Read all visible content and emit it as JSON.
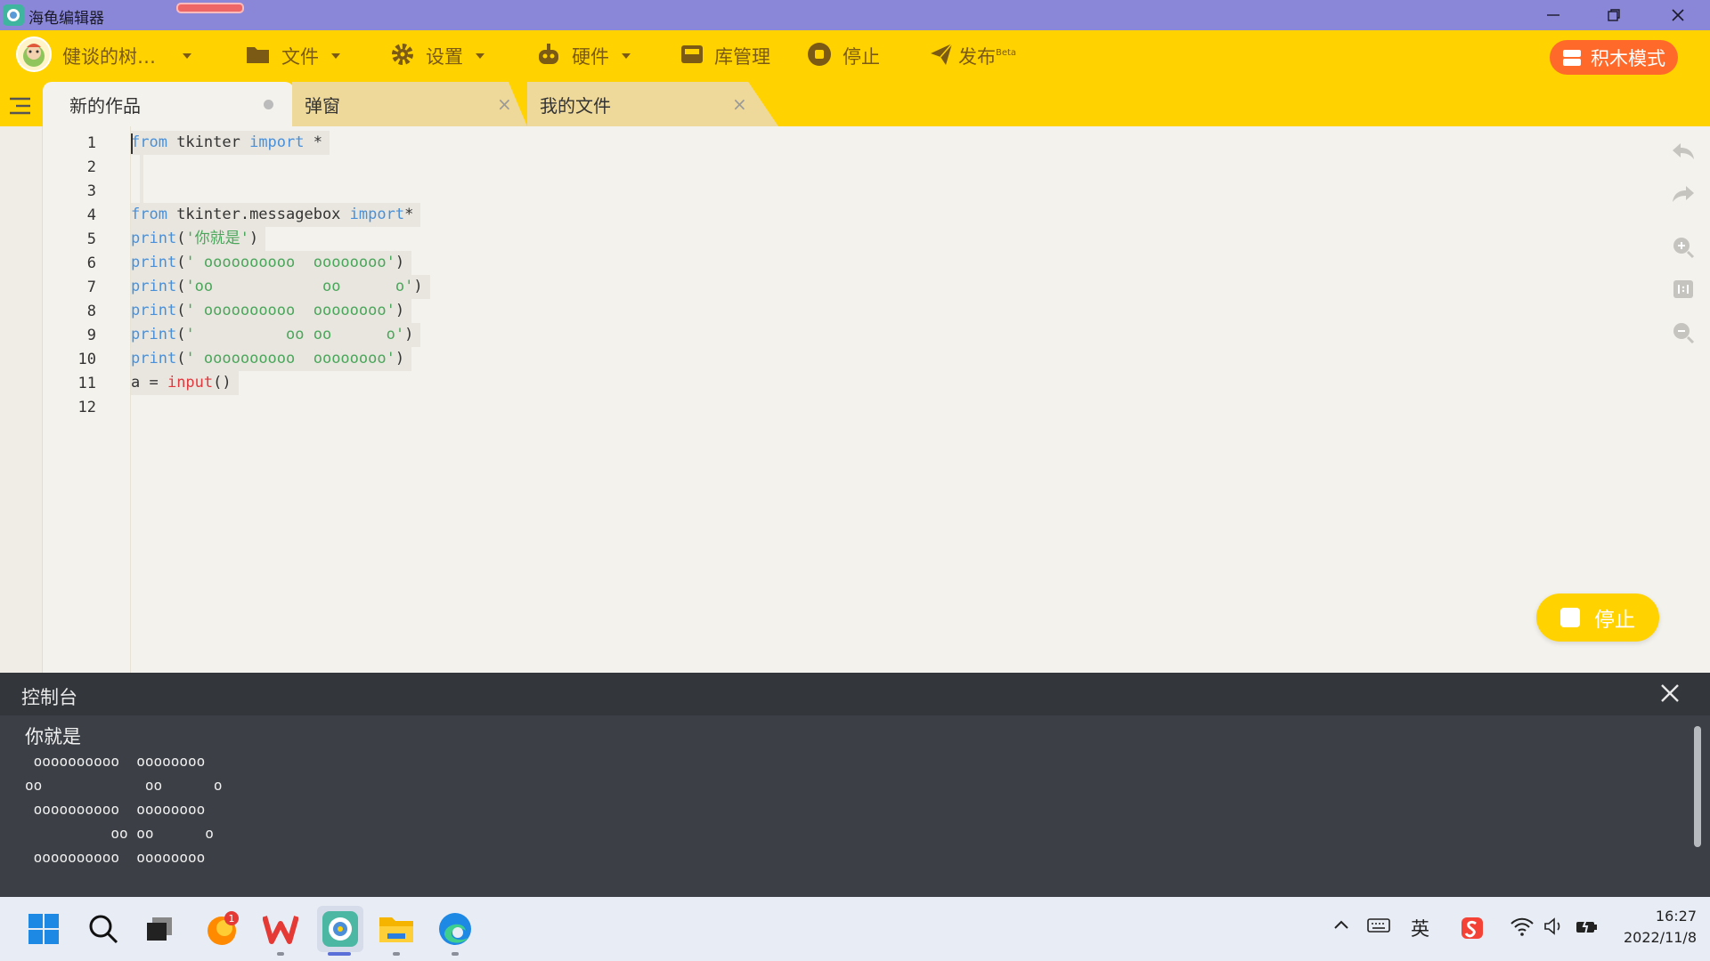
{
  "window": {
    "title": "海龟编辑器",
    "controls": [
      "minimize",
      "maximize",
      "close"
    ]
  },
  "toolbar": {
    "user_name": "健谈的树…",
    "file_label": "文件",
    "settings_label": "设置",
    "hardware_label": "硬件",
    "library_label": "库管理",
    "stop_label": "停止",
    "publish_label": "发布",
    "publish_badge": "Beta",
    "block_mode_label": "积木模式"
  },
  "tabs": [
    {
      "label": "新的作品",
      "state": "unsaved"
    },
    {
      "label": "弹窗",
      "close": "×"
    },
    {
      "label": "我的文件",
      "close": "×"
    }
  ],
  "editor": {
    "line_numbers": [
      "1",
      "2",
      "3",
      "4",
      "5",
      "6",
      "7",
      "8",
      "9",
      "10",
      "11",
      "12"
    ],
    "lines": {
      "l1": {
        "kw1": "from",
        "t1": " tkinter ",
        "kw2": "import",
        "t2": " *"
      },
      "l4": {
        "kw1": "from",
        "t1": " tkinter.messagebox ",
        "kw2": "import",
        "t2": "*"
      },
      "l5": {
        "fn": "print",
        "open": "(",
        "str": "'你就是'",
        "close": ")"
      },
      "l6": {
        "fn": "print",
        "open": "(",
        "str": "' oooooooooo  oooooooo'",
        "close": ")"
      },
      "l7": {
        "fn": "print",
        "open": "(",
        "str": "'oo            oo      o'",
        "close": ")"
      },
      "l8": {
        "fn": "print",
        "open": "(",
        "str": "' oooooooooo  oooooooo'",
        "close": ")"
      },
      "l9": {
        "fn": "print",
        "open": "(",
        "str": "'          oo oo      o'",
        "close": ")"
      },
      "l10": {
        "fn": "print",
        "open": "(",
        "str": "' oooooooooo  oooooooo'",
        "close": ")"
      },
      "l11": {
        "pre": "a = ",
        "fn": "input",
        "post": "()"
      }
    },
    "side_icons": [
      "undo-icon",
      "redo-icon",
      "zoom-in-icon",
      "reset-zoom-icon",
      "zoom-out-icon"
    ],
    "stop_button_label": "停止"
  },
  "console": {
    "title": "控制台",
    "output": [
      "你就是",
      " oooooooooo  oooooooo",
      "oo            oo      o",
      " oooooooooo  oooooooo",
      "          oo oo      o",
      " oooooooooo  oooooooo"
    ]
  },
  "taskbar": {
    "apps": [
      "windows-start-icon",
      "search-icon",
      "task-view-icon",
      "firefox-icon",
      "wps-icon",
      "turtle-editor-icon",
      "file-explorer-icon",
      "edge-icon"
    ],
    "firefox_badge": "1",
    "ime_label": "英",
    "time": "16:27",
    "date": "2022/11/8"
  },
  "colors": {
    "titlebar": "#8a86d8",
    "toolbar": "#ffd200",
    "toolbar_text": "#7a5a14",
    "block_mode_button": "#ff6a2a",
    "editor_bg": "#f4f2ec",
    "console_bg": "#3c4046",
    "keyword": "#4a90d9",
    "string": "#4aa65a",
    "builtin_red": "#e0393e"
  }
}
